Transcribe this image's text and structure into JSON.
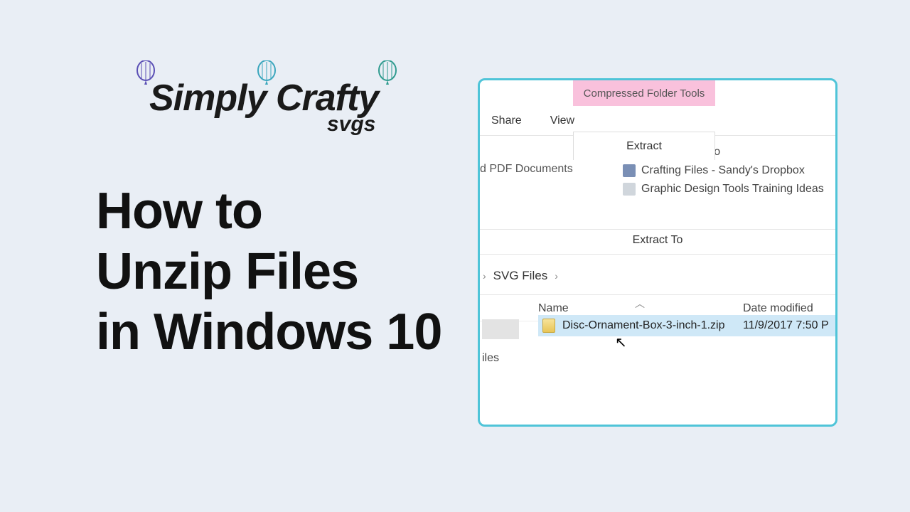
{
  "logo": {
    "main": "Simply Crafty",
    "sub": "svgs"
  },
  "headline": {
    "line1": "How to",
    "line2": "Unzip Files",
    "line3": "in Windows 10"
  },
  "explorer": {
    "context_header": "Compressed Folder Tools",
    "tabs": {
      "share": "Share",
      "view": "View",
      "extract": "Extract"
    },
    "extract_panel": {
      "left_fragment": "d PDF Documents",
      "destinations": [
        "Z-Business Info",
        "Crafting Files - Sandy's Dropbox",
        "Graphic Design Tools Training Ideas"
      ],
      "group_label": "Extract To"
    },
    "breadcrumb": {
      "folder": "SVG Files"
    },
    "columns": {
      "name": "Name",
      "date": "Date modified"
    },
    "sidebar_fragment": "iles",
    "file": {
      "name": "Disc-Ornament-Box-3-inch-1.zip",
      "date": "11/9/2017 7:50 P"
    }
  }
}
